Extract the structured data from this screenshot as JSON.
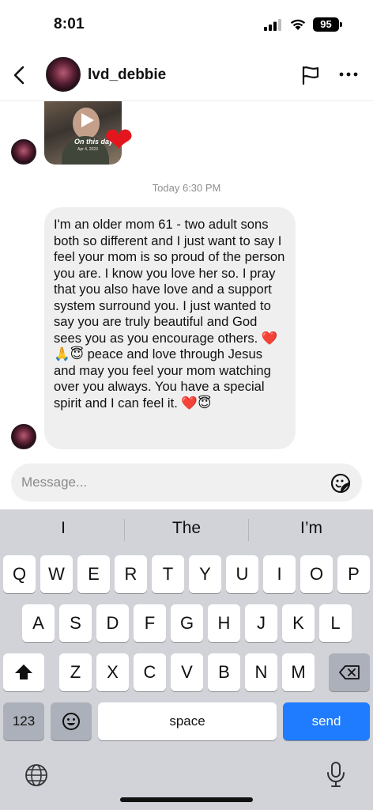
{
  "status_bar": {
    "time": "8:01",
    "battery": "95"
  },
  "header": {
    "username": "lvd_debbie"
  },
  "video_message": {
    "caption": "On this day",
    "date": "Apr 4, 2023"
  },
  "timestamp": "Today 6:30 PM",
  "message": {
    "text_1": "I'm an older mom 61 - two adult sons both so different  and I just want to say I feel your mom is so proud of the person you are. I know you love her so. I pray that you also have love and a support system surround you. I just wanted to say you are truly beautiful and God sees you as you encourage others. ",
    "emoji_1": "❤️🙏😇",
    "text_2": " peace and love through Jesus and may you feel your mom watching over you always. You have a special spirit and I can feel it. ",
    "emoji_2": "❤️😇"
  },
  "composer": {
    "placeholder": "Message..."
  },
  "keyboard": {
    "predictions": [
      "I",
      "The",
      "I’m"
    ],
    "row1": [
      "Q",
      "W",
      "E",
      "R",
      "T",
      "Y",
      "U",
      "I",
      "O",
      "P"
    ],
    "row2": [
      "A",
      "S",
      "D",
      "F",
      "G",
      "H",
      "J",
      "K",
      "L"
    ],
    "row3": [
      "Z",
      "X",
      "C",
      "V",
      "B",
      "N",
      "M"
    ],
    "numbers_label": "123",
    "space_label": "space",
    "send_label": "send"
  },
  "colors": {
    "send_blue": "#1f7cff",
    "heart_red": "#e3161e",
    "bubble_gray": "#efefef"
  }
}
